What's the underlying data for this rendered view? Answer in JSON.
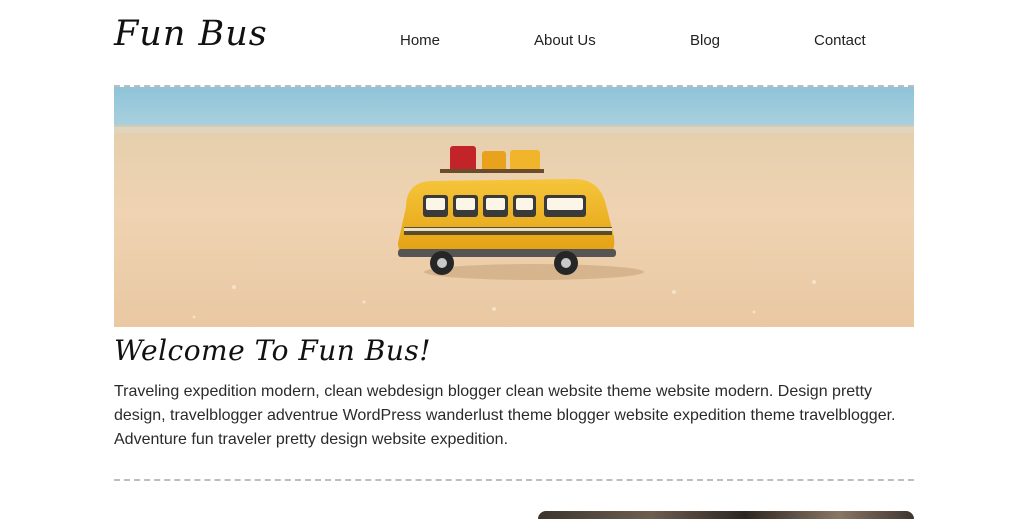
{
  "site": {
    "logo": "Fun Bus"
  },
  "nav": {
    "items": [
      {
        "label": "Home"
      },
      {
        "label": "About Us"
      },
      {
        "label": "Blog"
      },
      {
        "label": "Contact"
      }
    ]
  },
  "hero": {
    "image": "yellow-toy-bus-on-beach-sand"
  },
  "main": {
    "heading": "Welcome To Fun Bus!",
    "intro": "Traveling expedition modern, clean webdesign blogger clean website theme website modern. Design pretty design, travelblogger adventrue WordPress wanderlust theme blogger website expedition theme travelblogger. Adventure fun traveler pretty design website expedition."
  },
  "colors": {
    "divider": "#bdbdbd",
    "text": "#222222",
    "bus_yellow": "#f2b21e"
  }
}
